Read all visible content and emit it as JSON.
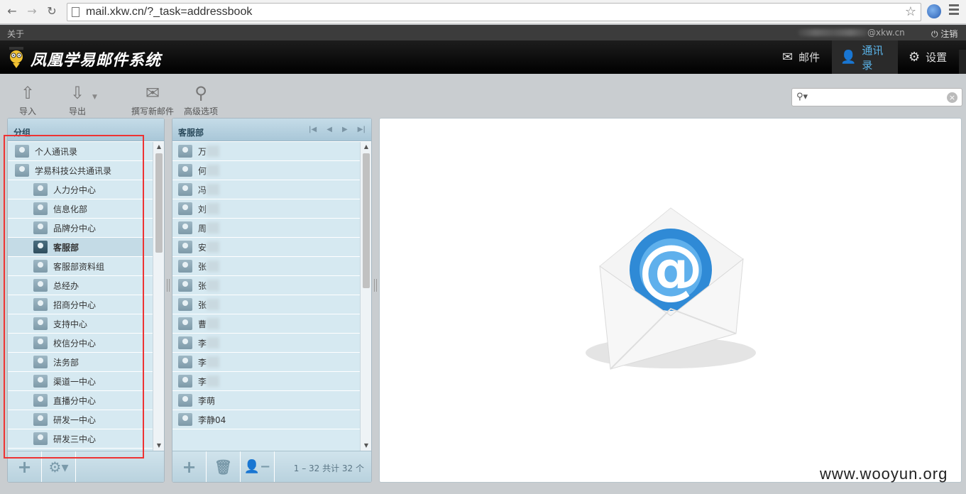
{
  "browser": {
    "url": "mail.xkw.cn/?_task=addressbook",
    "back_icon": "arrow-left-icon",
    "forward_icon": "arrow-right-icon",
    "reload_icon": "reload-icon"
  },
  "topbar": {
    "about": "关于",
    "user_email": "@xkw.cn",
    "logout": "注销"
  },
  "header": {
    "logo_text": "凤凰学易邮件系统",
    "nav": [
      {
        "label": "邮件",
        "icon": "envelope-icon"
      },
      {
        "label": "通讯录",
        "icon": "person-icon",
        "active": true
      },
      {
        "label": "设置",
        "icon": "gear-icon"
      }
    ]
  },
  "toolbar": {
    "import": "导入",
    "export": "导出",
    "compose": "撰写新邮件",
    "advanced": "高级选项",
    "search_placeholder": ""
  },
  "groups_panel": {
    "title": "分组",
    "items": [
      {
        "label": "个人通讯录",
        "level": 0
      },
      {
        "label": "学易科技公共通讯录",
        "level": 0
      },
      {
        "label": "人力分中心",
        "level": 1
      },
      {
        "label": "信息化部",
        "level": 1
      },
      {
        "label": "品牌分中心",
        "level": 1
      },
      {
        "label": "客服部",
        "level": 1,
        "selected": true
      },
      {
        "label": "客服部资料组",
        "level": 1
      },
      {
        "label": "总经办",
        "level": 1
      },
      {
        "label": "招商分中心",
        "level": 1
      },
      {
        "label": "支持中心",
        "level": 1
      },
      {
        "label": "校信分中心",
        "level": 1
      },
      {
        "label": "法务部",
        "level": 1
      },
      {
        "label": "渠道一中心",
        "level": 1
      },
      {
        "label": "直播分中心",
        "level": 1
      },
      {
        "label": "研发一中心",
        "level": 1
      },
      {
        "label": "研发三中心",
        "level": 1
      }
    ]
  },
  "contacts_panel": {
    "title": "客服部",
    "items": [
      "万",
      "何",
      "冯",
      "刘",
      "周",
      "安",
      "张",
      "张",
      "张",
      "曹",
      "李",
      "李",
      "李",
      "李萌",
      "李静04"
    ],
    "count_text": "1 – 32 共计 32 个"
  },
  "watermark": "www.wooyun.org",
  "colors": {
    "accent": "#5ab3e8",
    "panel_header": "#b4cfdd",
    "highlight_box": "#e33333"
  }
}
